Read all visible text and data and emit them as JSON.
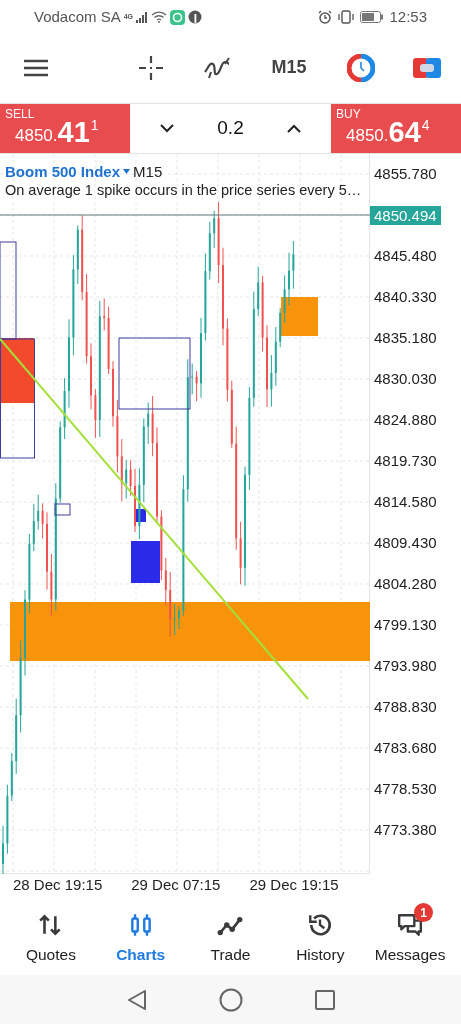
{
  "status_bar": {
    "carrier": "Vodacom SA",
    "network": "4G",
    "time": "12:53"
  },
  "toolbar": {
    "timeframe": "M15"
  },
  "trade_panel": {
    "sell": {
      "label": "SELL",
      "price": "4850.",
      "price_big": "41",
      "price_small": "1"
    },
    "volume": "0.2",
    "buy": {
      "label": "BUY",
      "price": "4850.",
      "price_big": "64",
      "price_small": "4"
    }
  },
  "chart": {
    "symbol": "Boom 500 Index",
    "timeframe": "M15",
    "description": "On average 1 spike occurs in the price series every 5…",
    "current_price": "4850.494",
    "price_labels": [
      "4855.780",
      "4845.480",
      "4840.330",
      "4835.180",
      "4830.030",
      "4824.880",
      "4819.730",
      "4814.580",
      "4809.430",
      "4804.280",
      "4799.130",
      "4793.980",
      "4788.830",
      "4783.680",
      "4778.530",
      "4773.380"
    ],
    "time_labels": [
      "28 Dec 19:15",
      "29 Dec 07:15",
      "29 Dec 19:15"
    ]
  },
  "nav": [
    {
      "kind": "quotes",
      "label": "Quotes",
      "selected": false
    },
    {
      "kind": "charts",
      "label": "Charts",
      "selected": true
    },
    {
      "kind": "trade",
      "label": "Trade",
      "selected": false
    },
    {
      "kind": "history",
      "label": "History",
      "selected": false
    },
    {
      "kind": "messages",
      "label": "Messages",
      "selected": false,
      "badge": "1"
    }
  ]
}
